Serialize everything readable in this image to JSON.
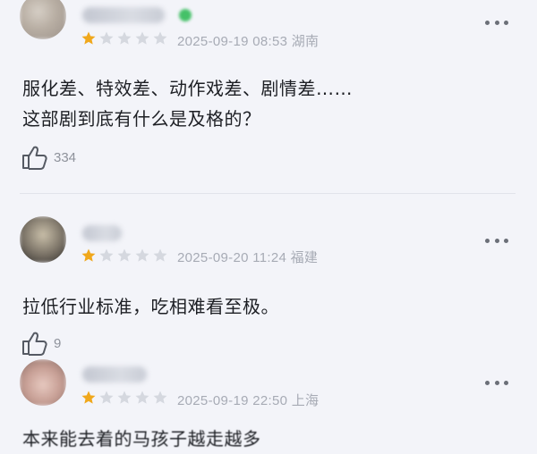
{
  "comments": [
    {
      "rating": 1,
      "date": "2025-09-19 08:53",
      "region": "湖南",
      "text_lines": [
        "服化差、特效差、动作戏差、剧情差……",
        "这部剧到底有什么是及格的？"
      ],
      "likes": "334"
    },
    {
      "rating": 1,
      "date": "2025-09-20 11:24",
      "region": "福建",
      "text_lines": [
        "拉低行业标准，吃相难看至极。"
      ],
      "likes": "9"
    },
    {
      "rating": 1,
      "date": "2025-09-19 22:50",
      "region": "上海",
      "text_lines": [
        "本来能去着的马孩子越走越多"
      ],
      "likes": ""
    }
  ],
  "colors": {
    "star_filled": "#f0a81c",
    "star_empty": "#d5d8df",
    "background": "#f3f4f9"
  },
  "icons": {
    "like": "thumbs-up-icon",
    "more": "more-dots-icon",
    "star": "star-icon"
  }
}
